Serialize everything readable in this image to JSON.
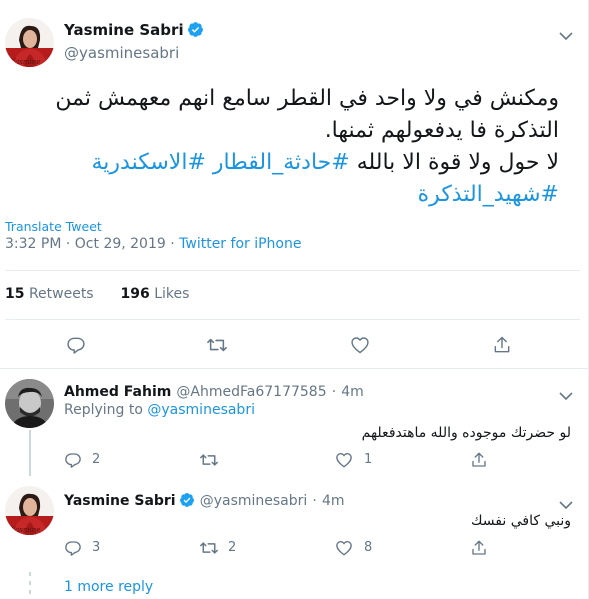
{
  "main_tweet": {
    "author_name": "Yasmine Sabri",
    "author_handle": "@yasminesabri",
    "text_line1": "ومكنش في ولا واحد في القطر سامع انهم معهمش ثمن",
    "text_line2": "التذكرة فا يدفعولهم ثمنها.",
    "text_line3_plain": "لا حول ولا قوة الا بالله",
    "hashtag1": "#حادثة_القطار",
    "hashtag2": "#الاسكندرية",
    "hashtag3": "#شهيد_التذكرة",
    "translate_label": "Translate Tweet",
    "time": "3:32 PM",
    "date": "Oct 29, 2019",
    "separator": "·",
    "source": "Twitter for iPhone",
    "retweets_count": "15",
    "retweets_label": "Retweets",
    "likes_count": "196",
    "likes_label": "Likes"
  },
  "replies": [
    {
      "author_name": "Ahmed Fahim",
      "author_handle": "@AhmedFa67177585",
      "time": "4m",
      "replying_label": "Replying to",
      "replying_to": "@yasminesabri",
      "text": "لو حضرتك موجوده والله ماهتدفعلهم",
      "reply_count": "2",
      "retweet_count": "",
      "like_count": "1"
    },
    {
      "author_name": "Yasmine Sabri",
      "author_handle": "@yasminesabri",
      "time": "4m",
      "text": "ونبي كافي نفسك",
      "reply_count": "3",
      "retweet_count": "2",
      "like_count": "8"
    }
  ],
  "more_replies_label": "1 more reply",
  "icons": [
    "reply-icon",
    "retweet-icon",
    "like-icon",
    "share-icon",
    "verified-icon",
    "chevron-down-icon"
  ],
  "colors": {
    "accent": "#1b95e0",
    "muted": "#657786",
    "divider": "#e6ecf0",
    "verified": "#1da1f2"
  }
}
